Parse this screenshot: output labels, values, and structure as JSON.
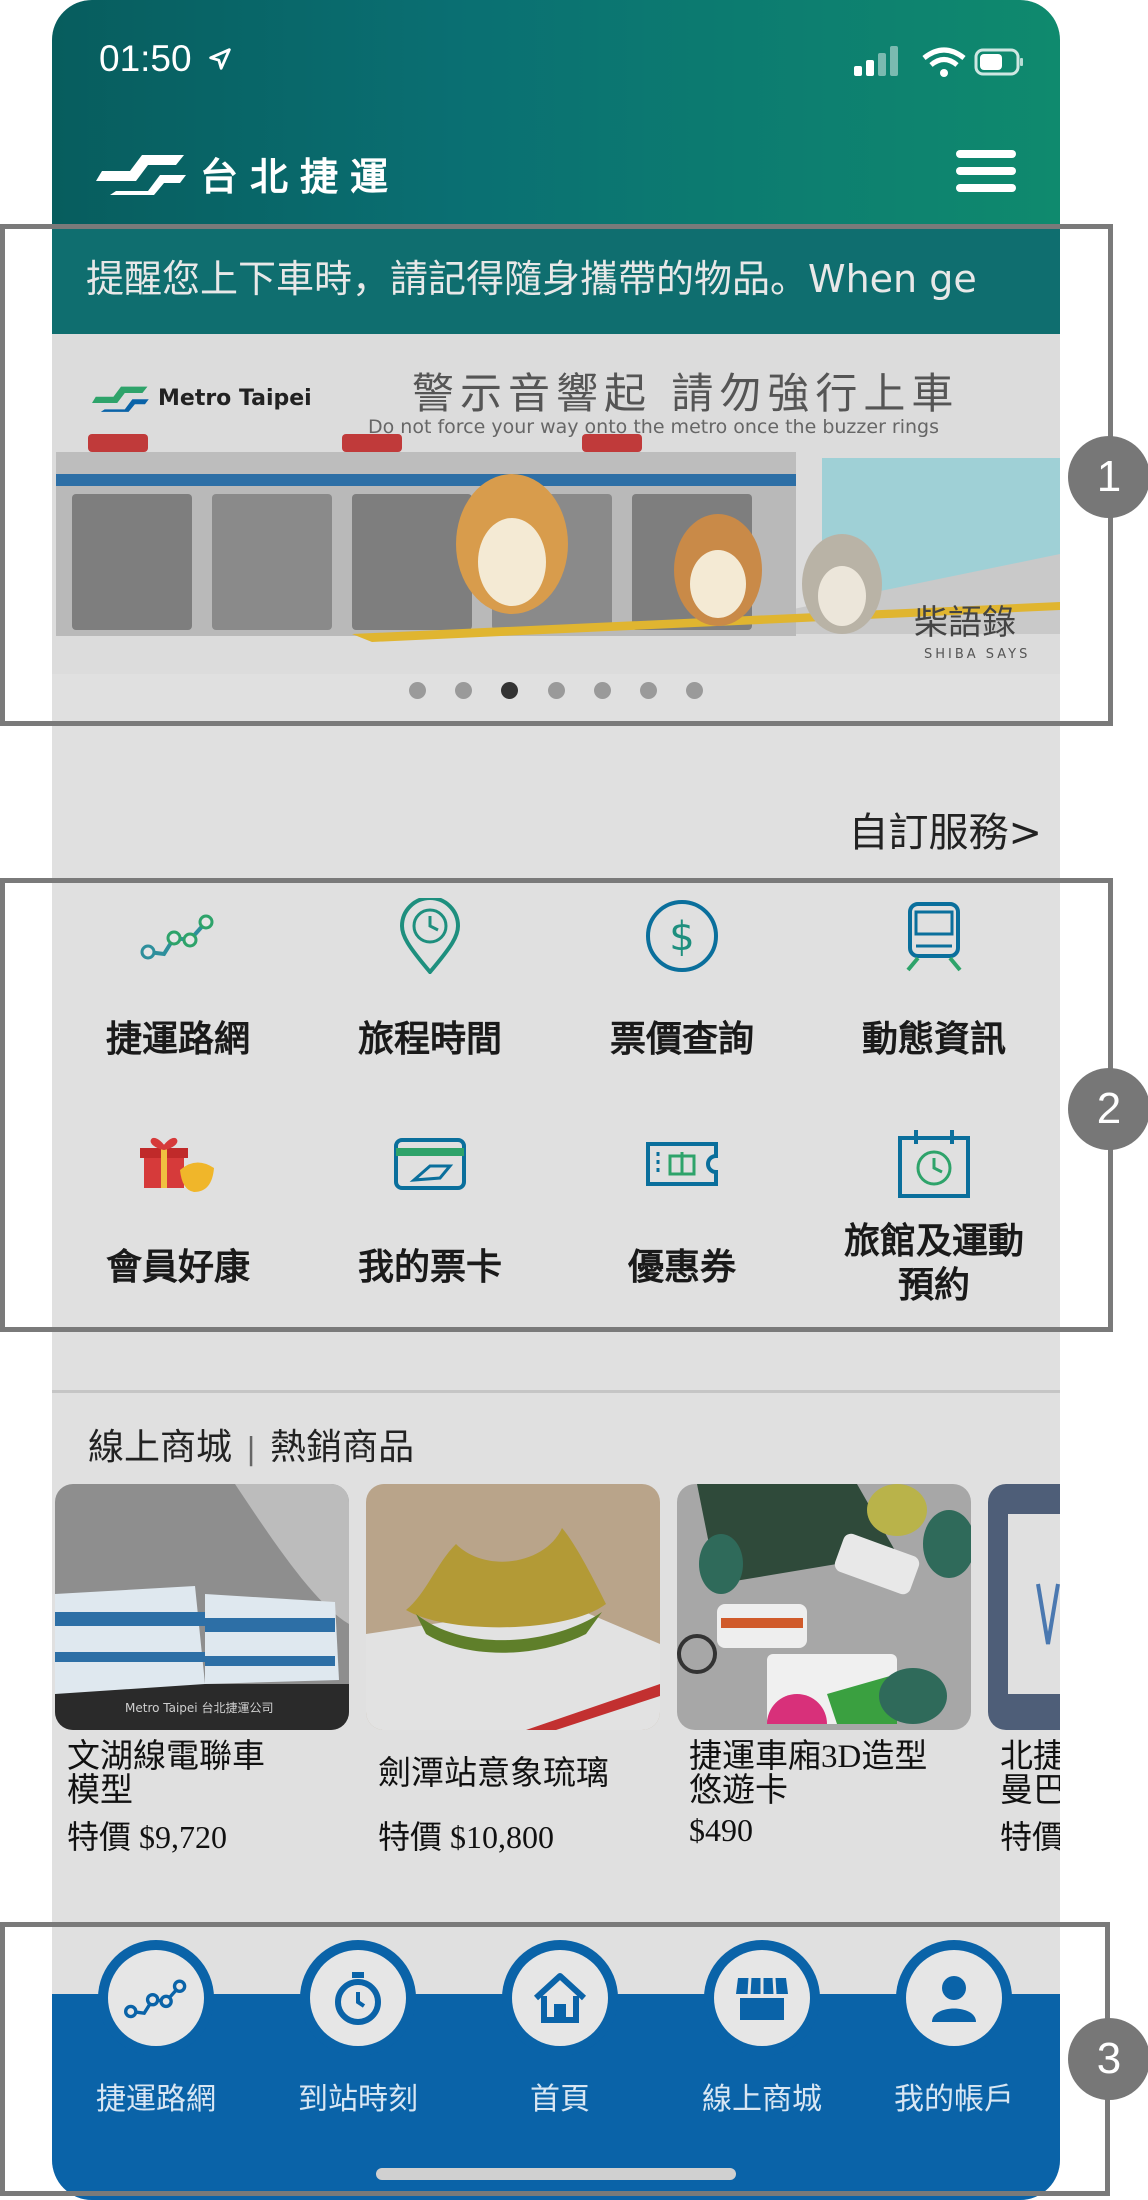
{
  "status_bar": {
    "time": "01:50"
  },
  "header": {
    "logo_text": "台北捷運"
  },
  "ticker": {
    "text": "提醒您上下車時，請記得隨身攜帶的物品。When ge"
  },
  "banner": {
    "title": "警示音響起 請勿強行上車",
    "subtitle": "Do not force your way onto the metro once the buzzer rings",
    "logo_text": "Metro Taipei",
    "brand_text": "柴語錄",
    "brand_sub": "SHIBA SAYS",
    "dot_count": 7,
    "active_dot": 3
  },
  "custom_service": "自訂服務>",
  "services": [
    {
      "label": "捷運路網",
      "icon": "metro-map-icon"
    },
    {
      "label": "旅程時間",
      "icon": "clock-pin-icon"
    },
    {
      "label": "票價查詢",
      "icon": "dollar-icon"
    },
    {
      "label": "動態資訊",
      "icon": "train-icon"
    },
    {
      "label": "會員好康",
      "icon": "gift-icon"
    },
    {
      "label": "我的票卡",
      "icon": "card-icon"
    },
    {
      "label": "優惠券",
      "icon": "coupon-icon"
    },
    {
      "label": "旅館及運動預約",
      "line1": "旅館及運動",
      "line2": "預約",
      "icon": "calendar-icon"
    }
  ],
  "shop": {
    "title": "線上商城",
    "separator": "|",
    "subtitle": "熱銷商品",
    "products": [
      {
        "name_line1": "文湖線電聯車",
        "name_line2": "模型",
        "price": "特價 $9,720",
        "img_text": "Metro Taipei 台北捷運公司"
      },
      {
        "name_line1": "劍潭站意象琉璃",
        "name_line2": "",
        "price": "特價 $10,800"
      },
      {
        "name_line1": "捷運車廂3D造型",
        "name_line2": "悠遊卡",
        "price": "$490"
      },
      {
        "name_line1": "北捷",
        "name_line2": "曼巴",
        "price": "特價"
      }
    ]
  },
  "tabbar": [
    {
      "label": "捷運路網",
      "icon": "metro-map-icon"
    },
    {
      "label": "到站時刻",
      "icon": "stopwatch-icon"
    },
    {
      "label": "首頁",
      "icon": "home-icon"
    },
    {
      "label": "線上商城",
      "icon": "store-icon"
    },
    {
      "label": "我的帳戶",
      "icon": "user-icon"
    }
  ],
  "callouts": [
    "1",
    "2",
    "3"
  ],
  "colors": {
    "header": "#0a6f72",
    "tabbar": "#0a63a8",
    "accent_green": "#2ea36a"
  }
}
